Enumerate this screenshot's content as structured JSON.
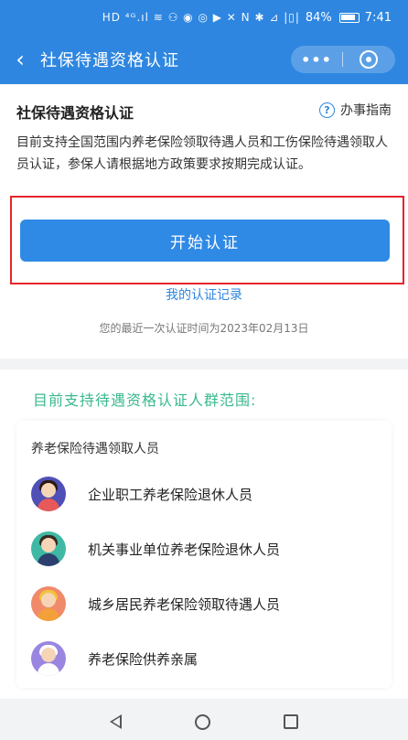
{
  "status_bar": {
    "icons_text": "HD ⁴ᴳ.ıl ≋ ⚇ ◉ ◎ ▶ ✕ N ✱ ⊿ |▯|",
    "battery": "84%",
    "time": "7:41"
  },
  "title_bar": {
    "back_icon": "chevron-left-icon",
    "title": "社保待遇资格认证",
    "more_label": "•••"
  },
  "auth_card": {
    "title": "社保待遇资格认证",
    "guide_label": "办事指南",
    "guide_icon_glyph": "?",
    "description": "目前支持全国范围内养老保险领取待遇人员和工伤保险待遇领取人员认证，参保人请根据地方政策要求按期完成认证。",
    "start_button": "开始认证",
    "record_link": "我的认证记录",
    "last_auth_text": "您的最近一次认证时间为2023年02月13日"
  },
  "scope": {
    "title": "目前支持待遇资格认证人群范围:",
    "group_label": "养老保险待遇领取人员",
    "items": [
      {
        "label": "企业职工养老保险退休人员",
        "avatar_bg": "#4f4fb6",
        "hair": "#2b1a14",
        "body": "#e85a5a"
      },
      {
        "label": "机关事业单位养老保险退休人员",
        "avatar_bg": "#3fb9a3",
        "hair": "#3a2a22",
        "body": "#2d3f6e"
      },
      {
        "label": "城乡居民养老保险领取待遇人员",
        "avatar_bg": "#f08a6a",
        "hair": "#f3c23a",
        "body": "#f3a03a"
      },
      {
        "label": "养老保险供养亲属",
        "avatar_bg": "#9a86e0",
        "hair": "#ffffff",
        "body": "#ffffff"
      }
    ]
  },
  "colors": {
    "primary": "#2e86e0",
    "accent_green": "#39b98b",
    "highlight_red": "#e5262d"
  }
}
